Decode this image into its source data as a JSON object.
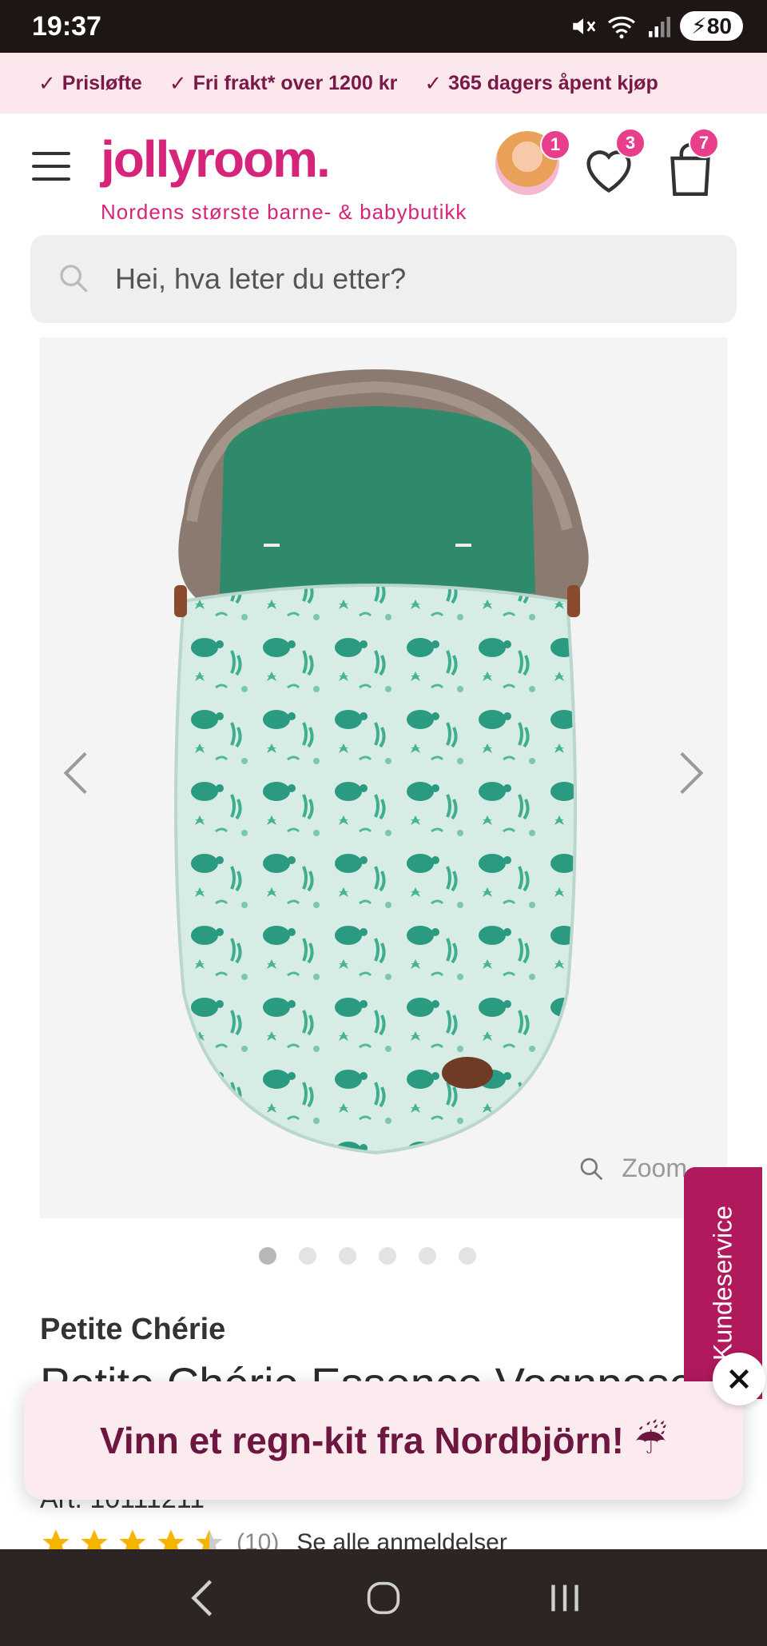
{
  "status_bar": {
    "time": "19:37",
    "battery": "80"
  },
  "promo_strip": {
    "items": [
      {
        "label": "Prisløfte"
      },
      {
        "label": "Fri frakt* over 1200 kr"
      },
      {
        "label": "365 dagers åpent kjøp"
      }
    ],
    "text_color": "#7a1848",
    "background": "#fbe7ec"
  },
  "header": {
    "logo": "jollyroom.",
    "tagline": "Nordens største barne- & babybutikk",
    "avatar_badge": "1",
    "wishlist_badge": "3",
    "cart_badge": "7",
    "brand_color": "#d6247a"
  },
  "search": {
    "placeholder": "Hei, hva leter du etter?"
  },
  "gallery": {
    "zoom_label": "Zoom",
    "image_count": 6,
    "active_index": 0
  },
  "product": {
    "brand": "Petite Chérie",
    "title": "Petite Chérie Essence Vognpose",
    "article": "Art. 10111211",
    "rating": 4.5,
    "rating_count": "(10)",
    "reviews_link": "Se alle anmeldelser"
  },
  "kundeservice": {
    "label": "Kundeservice",
    "color": "#b0195c"
  },
  "popup": {
    "text": "Vinn et regn-kit fra Nordbjörn! ☔"
  },
  "icons": {
    "menu": "hamburger-icon",
    "wishlist": "heart-icon",
    "cart": "bag-icon",
    "search": "search-icon",
    "zoom": "magnifier-icon"
  }
}
